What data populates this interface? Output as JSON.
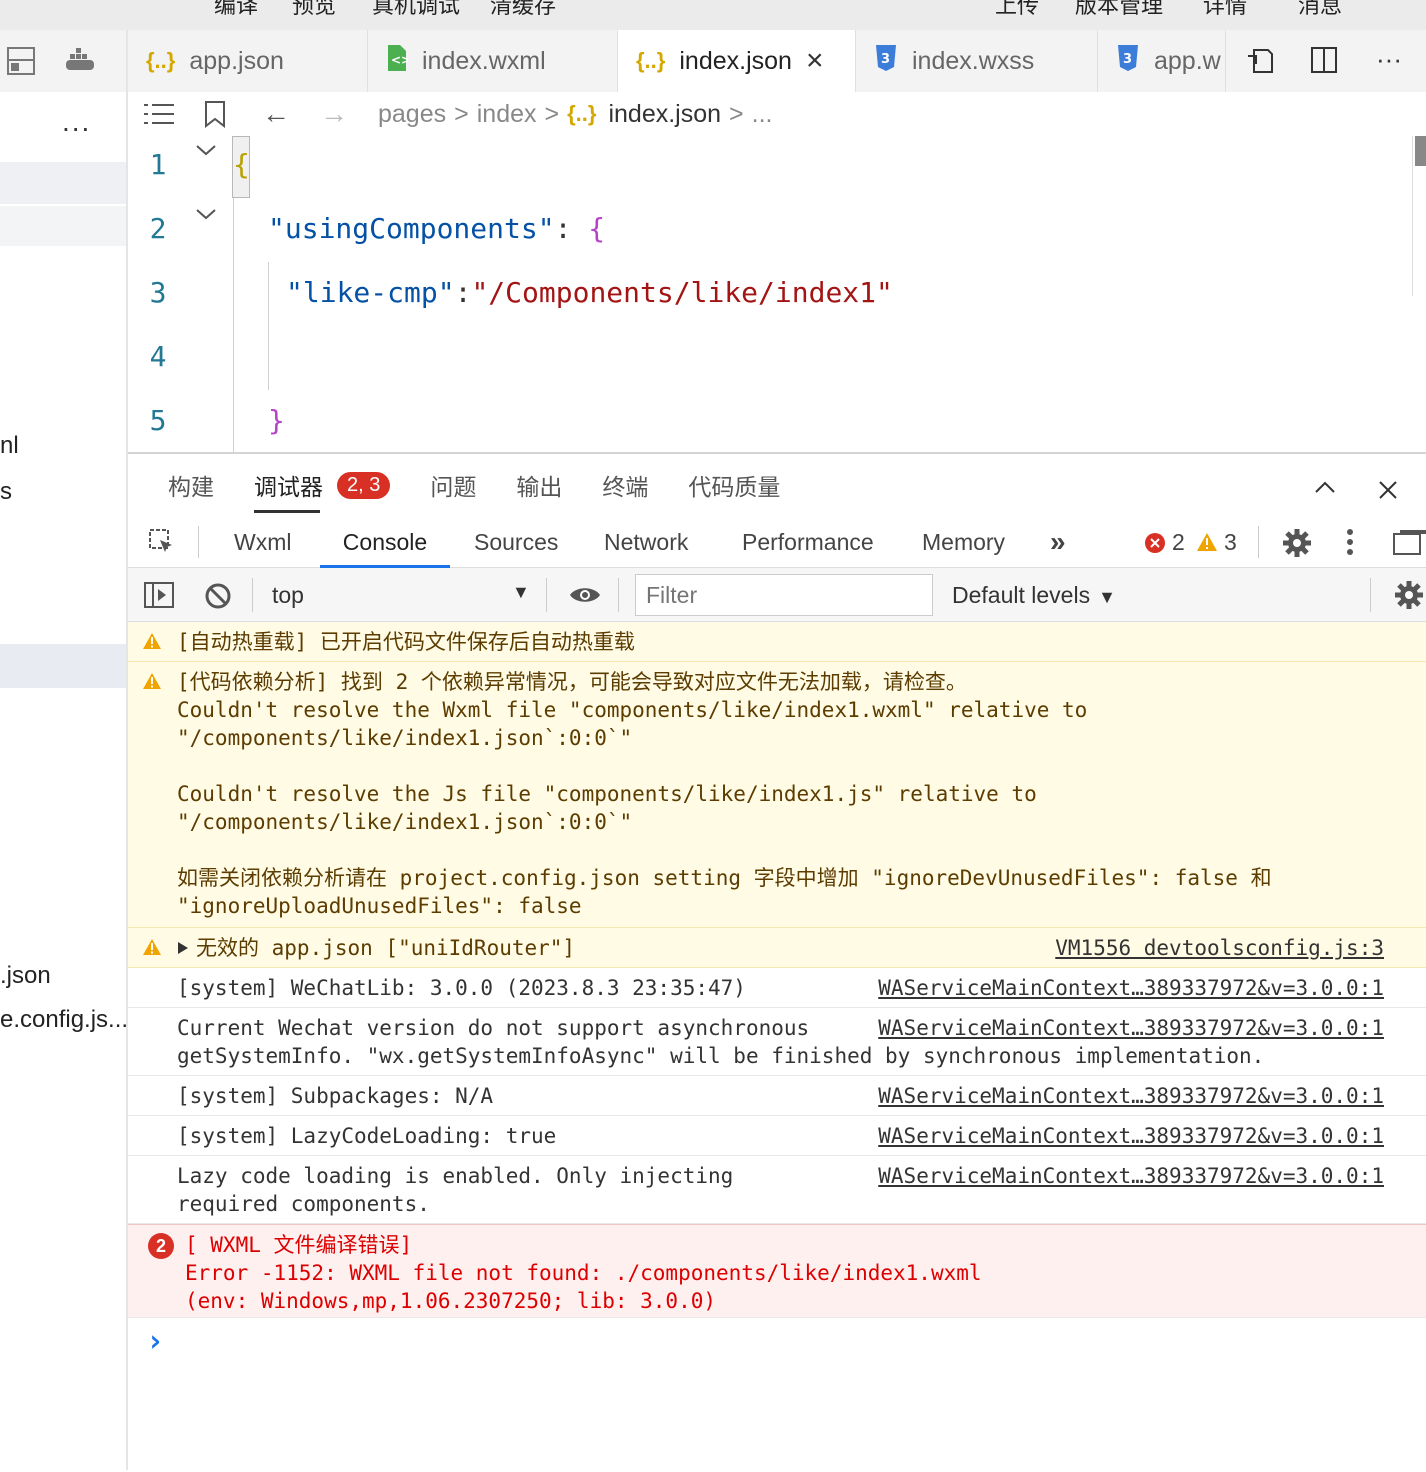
{
  "topbar": {
    "left": [
      "编译",
      "预览",
      "真机调试",
      "清缓存"
    ],
    "right": [
      "上传",
      "版本管理",
      "详情",
      "消息"
    ]
  },
  "sidebar": {
    "more": "...",
    "fragments": [
      "nl",
      "s",
      ".json",
      "e.config.js..."
    ]
  },
  "tabs": [
    {
      "icon": "{..}",
      "label": "app.json"
    },
    {
      "icon": "◇",
      "label": "index.wxml"
    },
    {
      "icon": "{..}",
      "label": "index.json",
      "close": "×"
    },
    {
      "icon": "3",
      "label": "index.wxss"
    },
    {
      "icon": "3",
      "label": "app.w"
    }
  ],
  "tab_actions": {
    "more": "···"
  },
  "breadcrumb": {
    "parts": [
      "pages",
      "index",
      "index.json",
      "..."
    ],
    "sep": ">"
  },
  "editor": {
    "line_numbers": [
      "1",
      "2",
      "3",
      "4",
      "5"
    ],
    "lines": {
      "l1": "{",
      "l2_key": "\"usingComponents\"",
      "l2_colon": ": ",
      "l2_brace": "{",
      "l3_key": "\"like-cmp\"",
      "l3_colon": ":",
      "l3_val": "\"/Components/like/index1\"",
      "l5": "}"
    }
  },
  "panel_tabs": [
    "构建",
    "调试器",
    "问题",
    "输出",
    "终端",
    "代码质量"
  ],
  "debugger_badge": "2, 3",
  "devtools_tabs": [
    "Wxml",
    "Console",
    "Sources",
    "Network",
    "Performance",
    "Memory"
  ],
  "devtools_more": "»",
  "counts": {
    "errors": "2",
    "warnings": "3"
  },
  "toolbar": {
    "context": "top",
    "filter_placeholder": "Filter",
    "levels": "Default levels"
  },
  "messages": {
    "m1": "[自动热重载] 已开启代码文件保存后自动热重载",
    "m2": "[代码依赖分析] 找到 2 个依赖异常情况，可能会导致对应文件无法加载，请检查。\nCouldn't resolve the Wxml file \"components/like/index1.wxml\" relative to\n\"/components/like/index1.json`:0:0`\"\n\nCouldn't resolve the Js file \"components/like/index1.js\" relative to\n\"/components/like/index1.json`:0:0`\"\n\n如需关闭依赖分析请在 project.config.json setting 字段中增加 \"ignoreDevUnusedFiles\": false 和\n\"ignoreUploadUnusedFiles\": false",
    "m3": "无效的 app.json [\"uniIdRouter\"]",
    "m3_src": "VM1556 devtoolsconfig.js:3",
    "m4": "[system] WeChatLib: 3.0.0 (2023.8.3 23:35:47)",
    "m5": "Current Wechat version do not support asynchronous\ngetSystemInfo. \"wx.getSystemInfoAsync\" will be finished by synchronous implementation.",
    "m6": "[system] Subpackages: N/A",
    "m7": "[system] LazyCodeLoading: true",
    "m8": "Lazy code loading is enabled. Only injecting\nrequired components.",
    "src": "WAServiceMainContext…389337972&v=3.0.0:1",
    "err_count": "2",
    "err": "[ WXML 文件编译错误]\nError -1152: WXML file not found: ./components/like/index1.wxml\n(env: Windows,mp,1.06.2307250; lib: 3.0.0)",
    "prompt": "›"
  },
  "colors": {
    "accent": "#1a73e8",
    "warning": "#f0a400",
    "error": "#d93025",
    "string": "#a31515",
    "key": "#0451a5"
  }
}
